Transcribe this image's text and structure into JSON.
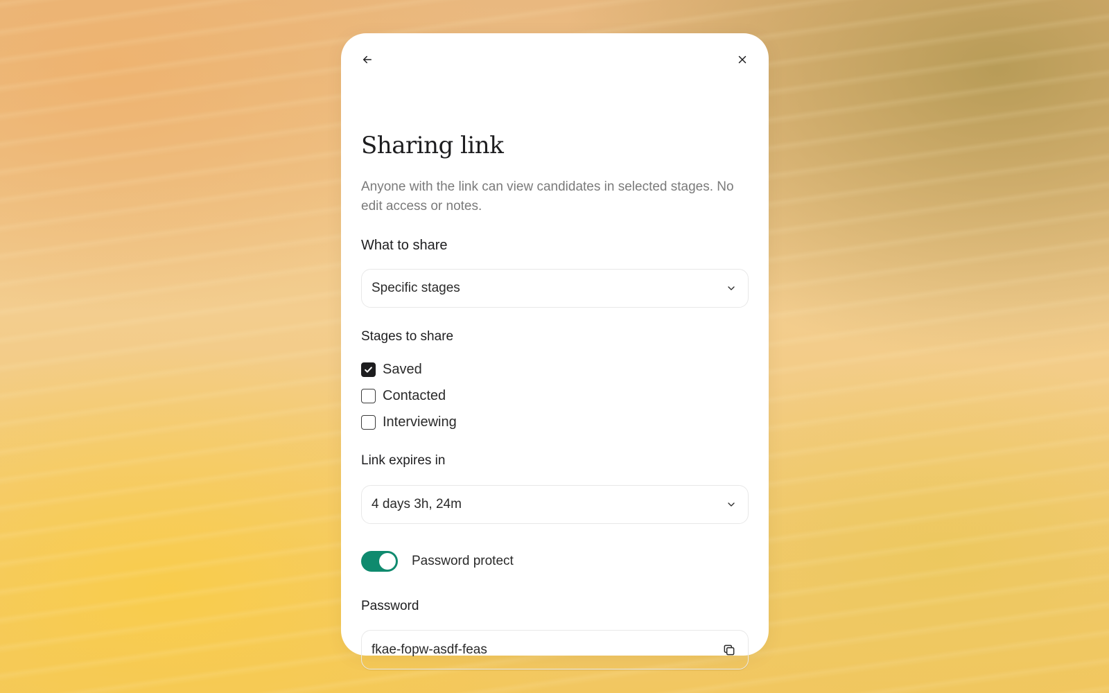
{
  "dialog": {
    "title": "Sharing link",
    "description": "Anyone with the link can view candidates in selected stages. No edit access or notes."
  },
  "what_to_share": {
    "label": "What to share",
    "selected": "Specific stages"
  },
  "stages": {
    "label": "Stages to share",
    "items": [
      {
        "label": "Saved",
        "checked": true
      },
      {
        "label": "Contacted",
        "checked": false
      },
      {
        "label": "Interviewing",
        "checked": false
      }
    ]
  },
  "expiry": {
    "label": "Link expires in",
    "selected": "4 days 3h, 24m"
  },
  "password_protect": {
    "label": "Password protect",
    "enabled": true,
    "accent_color": "#0f8a6e"
  },
  "password": {
    "label": "Password",
    "value": "fkae-fopw-asdf-feas"
  },
  "icons": {
    "back": "arrow-left-icon",
    "close": "close-icon",
    "dropdown": "chevron-down-icon",
    "copy": "copy-icon"
  }
}
